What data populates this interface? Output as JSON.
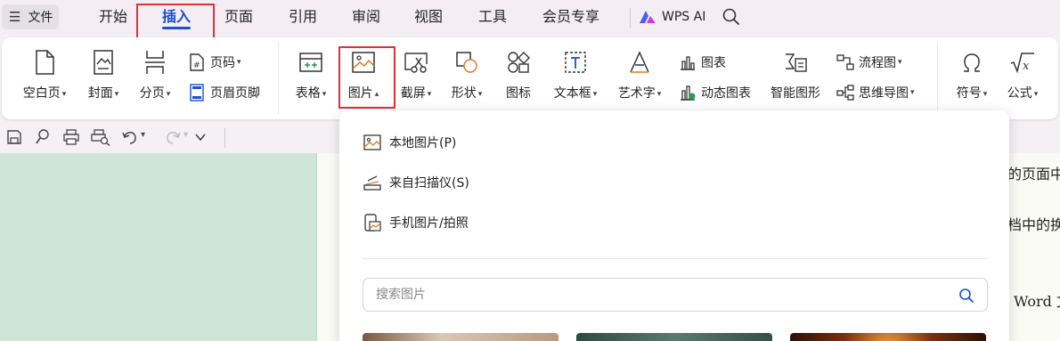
{
  "menubar": {
    "file_label": "文件",
    "tabs": [
      {
        "label": "开始"
      },
      {
        "label": "插入"
      },
      {
        "label": "页面"
      },
      {
        "label": "引用"
      },
      {
        "label": "审阅"
      },
      {
        "label": "视图"
      },
      {
        "label": "工具"
      },
      {
        "label": "会员专享"
      }
    ],
    "active_tab": "插入",
    "wps_ai_label": "WPS AI"
  },
  "ribbon": {
    "blank_page": "空白页",
    "cover": "封面",
    "page_break": "分页",
    "page_number": "页码",
    "header_footer": "页眉页脚",
    "table": "表格",
    "picture": "图片",
    "screenshot": "截屏",
    "shape": "形状",
    "icon": "图标",
    "textbox": "文本框",
    "wordart": "艺术字",
    "chart": "图表",
    "dynamic_chart": "动态图表",
    "smart_graphic": "智能图形",
    "flowchart": "流程图",
    "mindmap": "思维导图",
    "symbol": "符号",
    "formula": "公式"
  },
  "document": {
    "line1": "的页面中",
    "line2": "档中的换",
    "line3": "Word 文"
  },
  "picture_menu": {
    "local_picture": "本地图片(P)",
    "from_scanner": "来自扫描仪(S)",
    "phone_picture": "手机图片/拍照",
    "search_placeholder": "搜索图片"
  },
  "colors": {
    "accent": "#1a4fd1",
    "highlight_box": "#e0313a",
    "doc_background": "#cfe6d6"
  }
}
